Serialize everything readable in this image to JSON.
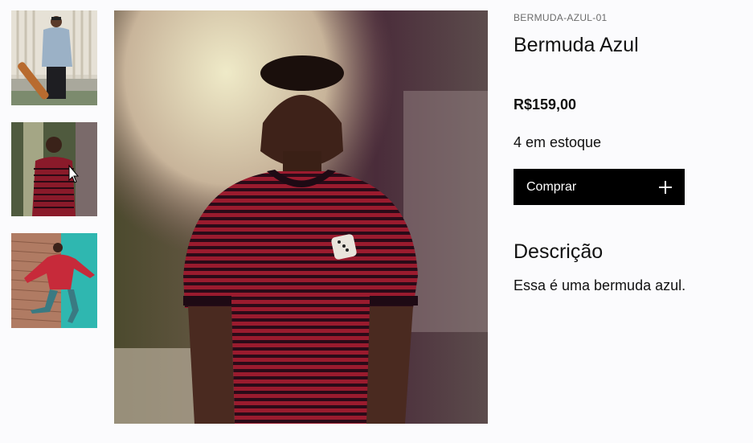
{
  "product": {
    "sku": "BERMUDA-AZUL-01",
    "name": "Bermuda Azul",
    "price": "R$159,00",
    "stock": "4 em estoque",
    "buy_label": "Comprar",
    "buy_icon": "plus-icon",
    "description_heading": "Descrição",
    "description": "Essa é uma bermuda azul."
  },
  "gallery": {
    "thumbnails": [
      {
        "subject": "man with skateboard, denim jacket"
      },
      {
        "subject": "man in red striped t-shirt",
        "selected": true
      },
      {
        "subject": "man in red hoodie jumping against brick wall"
      }
    ],
    "main_image": {
      "subject": "man in red striped t-shirt with dice patch"
    }
  },
  "colors": {
    "button_bg": "#000000",
    "button_text": "#ffffff",
    "page_bg": "#fbfbfd"
  }
}
